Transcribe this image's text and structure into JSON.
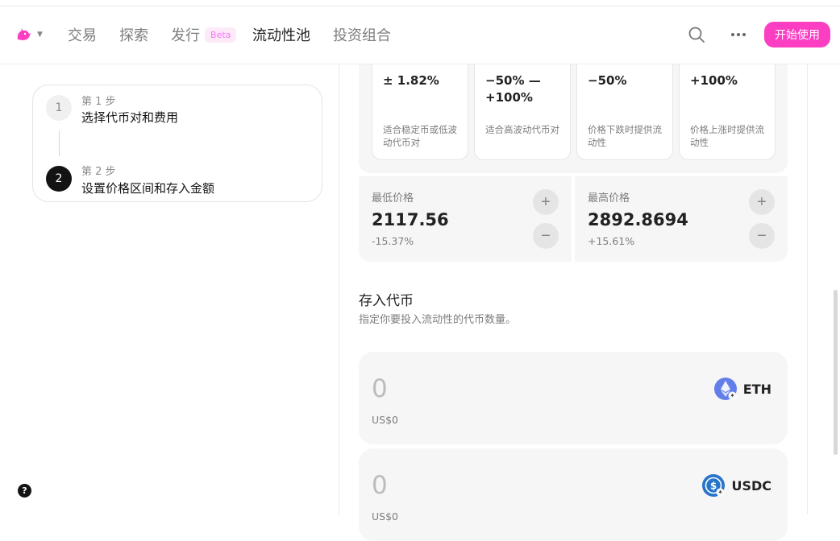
{
  "nav": {
    "items": [
      {
        "label": "交易"
      },
      {
        "label": "探索"
      },
      {
        "label": "发行",
        "badge": "Beta"
      },
      {
        "label": "流动性池"
      },
      {
        "label": "投资组合"
      }
    ],
    "start_button": "开始使用",
    "more_icon": "more-horizontal-icon",
    "search_icon": "search-icon",
    "accent": "#fc3ec2"
  },
  "steps": [
    {
      "number": "1",
      "sub": "第 1 步",
      "title": "选择代币对和费用"
    },
    {
      "number": "2",
      "sub": "第 2 步",
      "title": "设置价格区间和存入金额"
    }
  ],
  "presets": [
    {
      "value": "± 1.82%",
      "desc": "适合稳定币或低波动代币对"
    },
    {
      "value": "−50% — +100%",
      "desc": "适合高波动代币对"
    },
    {
      "value": "−50%",
      "desc": "价格下跌时提供流动性"
    },
    {
      "value": "+100%",
      "desc": "价格上涨时提供流动性"
    }
  ],
  "range": {
    "min": {
      "label": "最低价格",
      "value": "2117.56",
      "pct": "-15.37%"
    },
    "max": {
      "label": "最高价格",
      "value": "2892.8694",
      "pct": "+15.61%"
    }
  },
  "deposit": {
    "title": "存入代币",
    "subtitle": "指定你要投入流动性的代币数量。",
    "tokens": [
      {
        "amount": "0",
        "usd": "US$0",
        "symbol": "ETH",
        "color": "#627eea"
      },
      {
        "amount": "0",
        "usd": "US$0",
        "symbol": "USDC",
        "color": "#2775ca"
      }
    ]
  },
  "help": "?"
}
